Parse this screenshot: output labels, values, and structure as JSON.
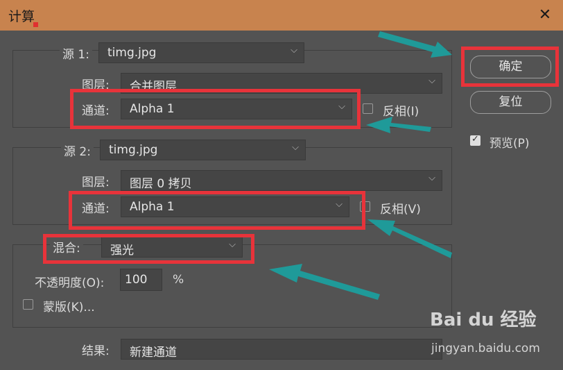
{
  "window": {
    "title": "计算"
  },
  "source1": {
    "label": "源 1:",
    "file": "timg.jpg",
    "layer_label": "图层:",
    "layer": "合并图层",
    "channel_label": "通道:",
    "channel": "Alpha 1",
    "invert_label": "反相(I)",
    "invert_checked": false
  },
  "source2": {
    "label": "源 2:",
    "file": "timg.jpg",
    "layer_label": "图层:",
    "layer": "图层 0 拷贝",
    "channel_label": "通道:",
    "channel": "Alpha 1",
    "invert_label": "反相(V)",
    "invert_checked": false
  },
  "blend": {
    "label": "混合:",
    "mode": "强光",
    "opacity_label": "不透明度(O):",
    "opacity": "100",
    "percent": "%",
    "mask_label": "蒙版(K)...",
    "mask_checked": false
  },
  "result": {
    "label": "结果:",
    "value": "新建通道"
  },
  "buttons": {
    "ok": "确定",
    "reset": "复位"
  },
  "preview": {
    "label": "预览(P)",
    "checked": true
  },
  "watermark": {
    "brand": "Bai du 经验",
    "url": "jingyan.baidu.com"
  },
  "colors": {
    "highlight": "#e8333a",
    "arrow": "#1f9a99",
    "titlebar": "#c8834e",
    "panel": "#535353"
  }
}
